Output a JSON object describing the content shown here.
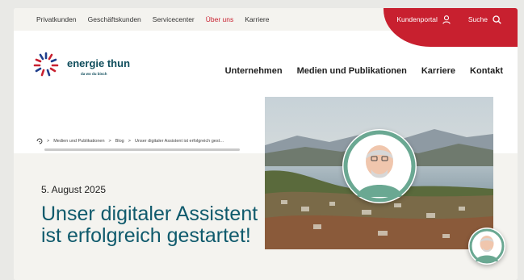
{
  "topbar": {
    "nav": [
      {
        "label": "Privatkunden",
        "active": false
      },
      {
        "label": "Geschäftskunden",
        "active": false
      },
      {
        "label": "Servicecenter",
        "active": false
      },
      {
        "label": "Über uns",
        "active": true
      },
      {
        "label": "Karriere",
        "active": false
      }
    ],
    "customer_portal": {
      "label": "Kundenportal",
      "icon": "user-icon"
    },
    "search": {
      "label": "Suche",
      "icon": "search-icon"
    }
  },
  "logo": {
    "name": "energie thun",
    "tagline": "da wo du bisch"
  },
  "main_nav": [
    "Unternehmen",
    "Medien und Publikationen",
    "Karriere",
    "Kontakt"
  ],
  "breadcrumb": {
    "home_icon": "home-icon",
    "items": [
      "Medien und Publikationen",
      "Blog",
      "Unser digitaler Assistent ist erfolgreich gest…"
    ]
  },
  "article": {
    "date": "5. August 2025",
    "title": "Unser digitaler Assistent ist erfolgreich gestartet!"
  },
  "colors": {
    "brand_red": "#c8202f",
    "brand_teal": "#0f5a6c",
    "beige": "#f4f3ef"
  },
  "assistant": {
    "large_icon": "assistant-avatar-icon",
    "chat_icon": "chat-assistant-icon"
  }
}
